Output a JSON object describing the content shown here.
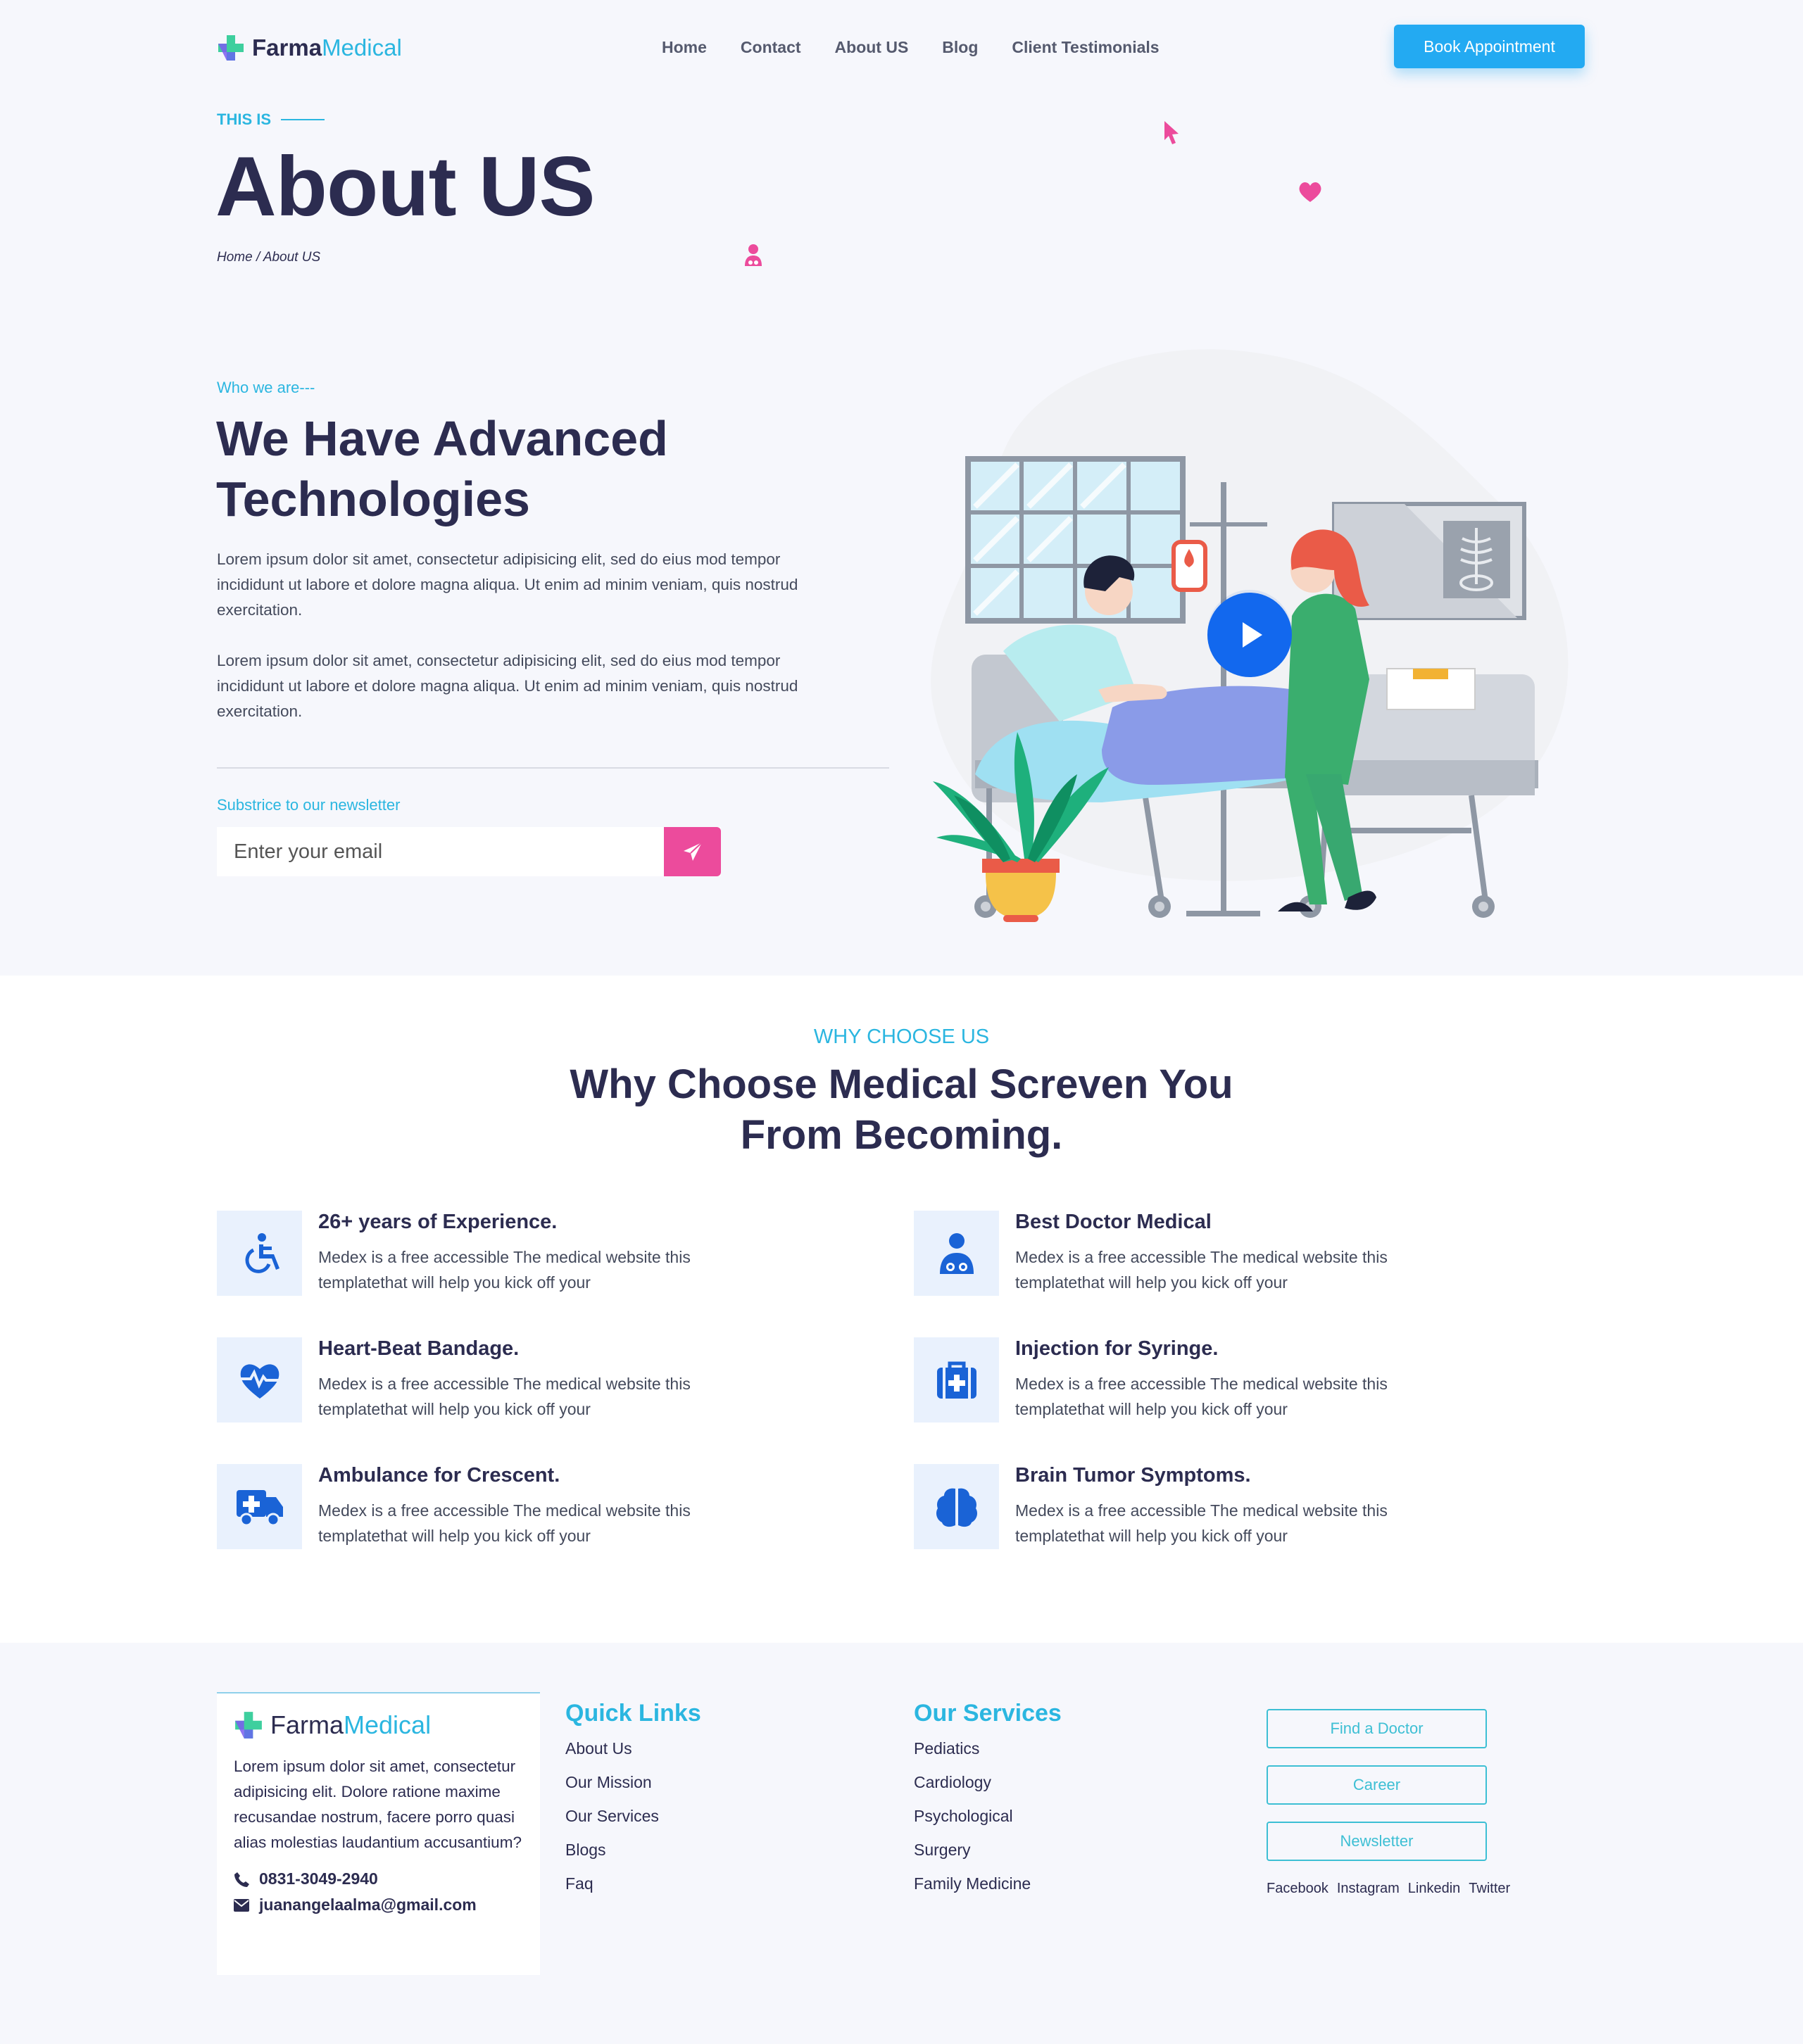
{
  "header": {
    "logo_part1": "Farma",
    "logo_part2": "Medical",
    "nav": [
      "Home",
      "Contact",
      "About US",
      "Blog",
      "Client Testimonials"
    ],
    "cta": "Book Appointment"
  },
  "hero": {
    "kicker": "THIS IS",
    "title": "About US",
    "breadcrumb": "Home / About US"
  },
  "about": {
    "kicker": "Who we are---",
    "title_line1": "We Have Advanced",
    "title_line2": "Technologies",
    "para1": "Lorem ipsum dolor sit amet, consectetur adipisicing elit, sed do eius mod tempor incididunt ut labore et dolore magna aliqua. Ut enim ad minim veniam, quis nostrud exercitation.",
    "para2": "Lorem ipsum dolor sit amet, consectetur adipisicing elit, sed do eius mod tempor incididunt ut labore et dolore magna aliqua. Ut enim ad minim veniam, quis nostrud exercitation.",
    "newsletter_label": "Substrice to our newsletter",
    "email_placeholder": "Enter your email"
  },
  "why": {
    "kicker": "WHY CHOOSE US",
    "title_line1": "Why Choose Medical Screven You",
    "title_line2": "From Becoming.",
    "features": [
      {
        "title": "26+ years of Experience.",
        "desc": "Medex is a free accessible The medical website this templatethat will help you kick off your",
        "icon": "wheelchair-icon"
      },
      {
        "title": "Best Doctor Medical",
        "desc": "Medex is a free accessible The medical website this templatethat will help you kick off your",
        "icon": "doctor-icon"
      },
      {
        "title": "Heart-Beat Bandage.",
        "desc": "Medex is a free accessible The medical website this templatethat will help you kick off your",
        "icon": "heartbeat-icon"
      },
      {
        "title": "Injection for Syringe.",
        "desc": "Medex is a free accessible The medical website this templatethat will help you kick off your",
        "icon": "medkit-icon"
      },
      {
        "title": "Ambulance for Crescent.",
        "desc": "Medex is a free accessible The medical website this templatethat will help you kick off your",
        "icon": "ambulance-icon"
      },
      {
        "title": "Brain Tumor Symptoms.",
        "desc": "Medex is a free accessible The medical website this templatethat will help you kick off your",
        "icon": "brain-icon"
      }
    ]
  },
  "footer": {
    "logo_part1": "Farma",
    "logo_part2": "Medical",
    "about": "Lorem ipsum dolor sit amet, consectetur adipisicing elit. Dolore ratione maxime recusandae nostrum, facere porro quasi alias molestias laudantium accusantium?",
    "phone": "0831-3049-2940",
    "email": "juanangelaalma@gmail.com",
    "quick_title": "Quick Links",
    "quick_links": [
      "About Us",
      "Our Mission",
      "Our Services",
      "Blogs",
      "Faq"
    ],
    "services_title": "Our Services",
    "services": [
      "Pediatics",
      "Cardiology",
      "Psychological",
      "Surgery",
      "Family Medicine"
    ],
    "buttons": [
      "Find a Doctor",
      "Career",
      "Newsletter"
    ],
    "social": [
      "Facebook",
      "Instagram",
      "Linkedin",
      "Twitter"
    ]
  },
  "colors": {
    "accent": "#2bb6e0",
    "brand_dark": "#2c2c50",
    "cta": "#23aaf2",
    "pink": "#ec4b9c",
    "icon_blue": "#1a63d6"
  }
}
